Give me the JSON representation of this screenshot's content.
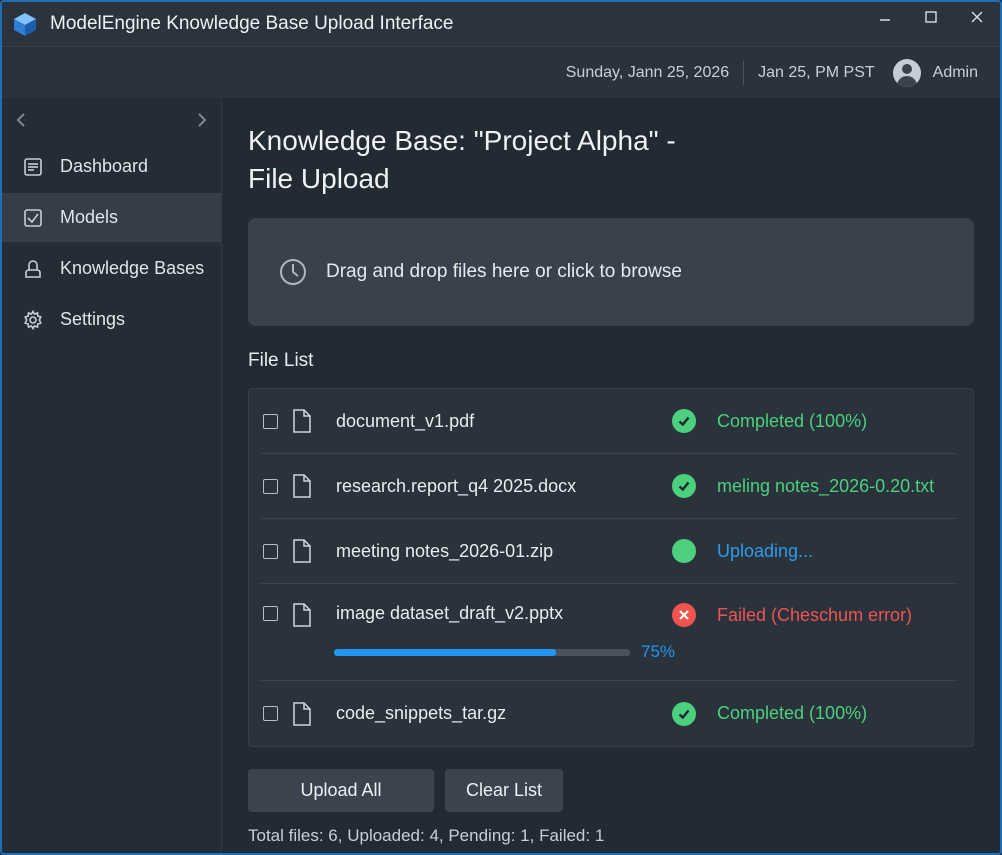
{
  "app": {
    "title": "ModelEngine Knowledge Base Upload Interface",
    "logo_icon": "cube-logo-icon"
  },
  "header": {
    "date": "Sunday, Jann 25, 2026",
    "time": "Jan 25, PM PST",
    "user_name": "Admin",
    "avatar_icon": "user-avatar-icon"
  },
  "sidebar": {
    "items": [
      {
        "label": "Dashboard",
        "icon": "dashboard-icon",
        "active": false
      },
      {
        "label": "Models",
        "icon": "checkbox-icon",
        "active": true
      },
      {
        "label": "Knowledge Bases",
        "icon": "stack-icon",
        "active": false
      },
      {
        "label": "Settings",
        "icon": "gear-icon",
        "active": false
      }
    ]
  },
  "main": {
    "title": "Knowledge Base: \"Project Alpha\" - File Upload",
    "dropzone_text": "Drag and drop files here or click to browse",
    "file_list_title": "File List",
    "files": [
      {
        "name": "document_v1.pdf",
        "status": "Completed (100%)",
        "state": "success"
      },
      {
        "name": "research.report_q4 2025.docx",
        "status": "meling notes_2026-0.20.txt",
        "state": "success"
      },
      {
        "name": "meeting notes_2026-01.zip",
        "status": "Uploading...",
        "state": "uploading"
      },
      {
        "name": "image dataset_draft_v2.pptx",
        "status": "Failed (Cheschum error)",
        "state": "failed",
        "progress": 75,
        "progress_label": "75%"
      },
      {
        "name": "code_snippets_tar.gz",
        "status": "Completed (100%)",
        "state": "success"
      }
    ],
    "upload_all_label": "Upload All",
    "clear_list_label": "Clear List",
    "summary": "Total files: 6, Uploaded: 4, Pending: 1, Failed: 1"
  },
  "colors": {
    "success": "#4cd07d",
    "uploading": "#2f9be8",
    "failed": "#ef5350",
    "accent": "#2196f3"
  }
}
